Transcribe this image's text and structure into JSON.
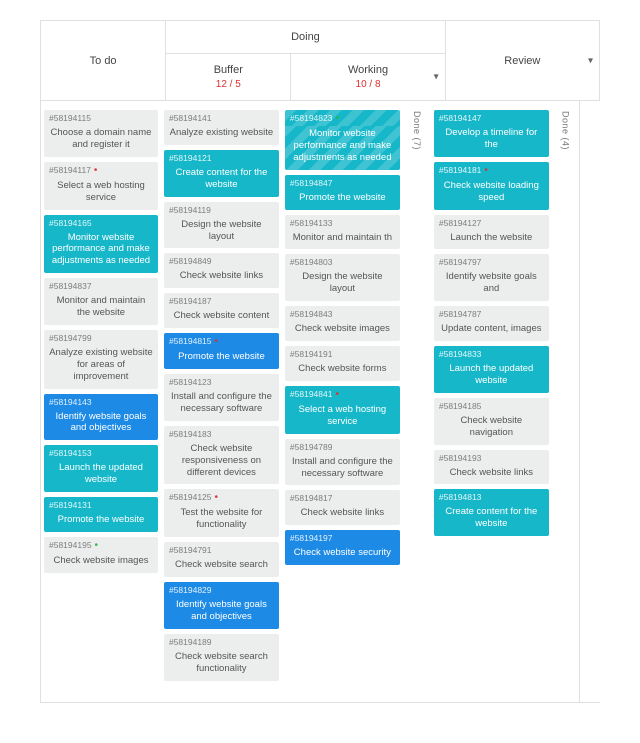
{
  "headers": {
    "todo": "To do",
    "doing": "Doing",
    "buffer": "Buffer",
    "buffer_wip": "12 / 5",
    "working": "Working",
    "working_wip": "10 / 8",
    "review": "Review"
  },
  "done_labels": {
    "left": "Done (7)",
    "right": "Done (4)"
  },
  "cards": {
    "todo": [
      {
        "id": "#58194115",
        "title": "Choose a domain name and register it",
        "style": "grey"
      },
      {
        "id": "#58194117",
        "title": "Select a web hosting service",
        "style": "grey",
        "flag": "red"
      },
      {
        "id": "#58194165",
        "title": "Monitor website performance and make adjustments as needed",
        "style": "teal"
      },
      {
        "id": "#58194837",
        "title": "Monitor and maintain the website",
        "style": "grey"
      },
      {
        "id": "#58194799",
        "title": "Analyze existing website for areas of improvement",
        "style": "grey"
      },
      {
        "id": "#58194143",
        "title": "Identify website goals and objectives",
        "style": "blue"
      },
      {
        "id": "#58194153",
        "title": "Launch the updated website",
        "style": "teal"
      },
      {
        "id": "#58194131",
        "title": "Promote the website",
        "style": "teal"
      },
      {
        "id": "#58194195",
        "title": "Check website images",
        "style": "grey",
        "flag": "green"
      }
    ],
    "buffer": [
      {
        "id": "#58194141",
        "title": "Analyze existing website",
        "style": "grey"
      },
      {
        "id": "#58194121",
        "title": "Create content for the website",
        "style": "teal"
      },
      {
        "id": "#58194119",
        "title": "Design the website layout",
        "style": "grey"
      },
      {
        "id": "#58194849",
        "title": "Check website links",
        "style": "grey"
      },
      {
        "id": "#58194187",
        "title": "Check website content",
        "style": "grey"
      },
      {
        "id": "#58194815",
        "title": "Promote the website",
        "style": "blue",
        "flag": "red"
      },
      {
        "id": "#58194123",
        "title": "Install and configure the necessary software",
        "style": "grey"
      },
      {
        "id": "#58194183",
        "title": "Check website responsiveness on different devices",
        "style": "grey"
      },
      {
        "id": "#58194125",
        "title": "Test the website for functionality",
        "style": "grey",
        "flag": "red"
      },
      {
        "id": "#58194791",
        "title": "Check website search",
        "style": "grey"
      },
      {
        "id": "#58194829",
        "title": "Identify website goals and objectives",
        "style": "blue"
      },
      {
        "id": "#58194189",
        "title": "Check website search functionality",
        "style": "grey"
      }
    ],
    "working": [
      {
        "id": "#58194823",
        "title": "Monitor website performance and make adjustments as needed",
        "style": "teal",
        "flag": "green",
        "stripes": true
      },
      {
        "id": "#58194847",
        "title": "Promote the website",
        "style": "teal"
      },
      {
        "id": "#58194133",
        "title": "Monitor and maintain th",
        "style": "grey"
      },
      {
        "id": "#58194803",
        "title": "Design the website layout",
        "style": "grey"
      },
      {
        "id": "#58194843",
        "title": "Check website images",
        "style": "grey"
      },
      {
        "id": "#58194191",
        "title": "Check website forms",
        "style": "grey"
      },
      {
        "id": "#58194841",
        "title": "Select a web hosting service",
        "style": "teal",
        "flag": "red"
      },
      {
        "id": "#58194789",
        "title": "Install and configure the necessary software",
        "style": "grey"
      },
      {
        "id": "#58194817",
        "title": "Check website links",
        "style": "grey"
      },
      {
        "id": "#58194197",
        "title": "Check website security",
        "style": "blue"
      }
    ],
    "review": [
      {
        "id": "#58194147",
        "title": "Develop a timeline for the",
        "style": "teal"
      },
      {
        "id": "#58194181",
        "title": "Check website loading speed",
        "style": "teal",
        "flag": "red"
      },
      {
        "id": "#58194127",
        "title": "Launch the website",
        "style": "grey"
      },
      {
        "id": "#58194797",
        "title": "Identify website goals and",
        "style": "grey"
      },
      {
        "id": "#58194787",
        "title": "Update content, images",
        "style": "grey"
      },
      {
        "id": "#58194833",
        "title": "Launch the updated website",
        "style": "teal"
      },
      {
        "id": "#58194185",
        "title": "Check website navigation",
        "style": "grey"
      },
      {
        "id": "#58194193",
        "title": "Check website links",
        "style": "grey"
      },
      {
        "id": "#58194813",
        "title": "Create content for the website",
        "style": "teal"
      }
    ]
  }
}
